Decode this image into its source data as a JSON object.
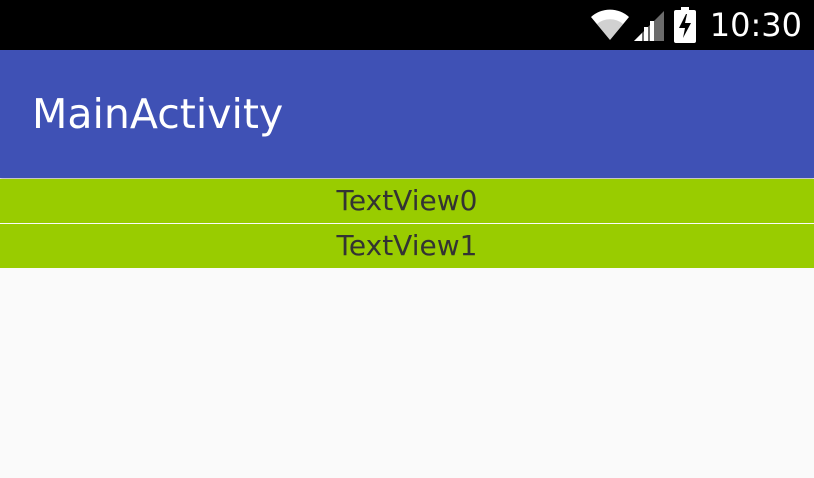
{
  "status_bar": {
    "time": "10:30",
    "icons": [
      "wifi-icon",
      "signal-icon",
      "battery-charging-icon"
    ]
  },
  "app_bar": {
    "title": "MainActivity"
  },
  "content": {
    "items": [
      {
        "label": "TextView0"
      },
      {
        "label": "TextView1"
      }
    ]
  },
  "colors": {
    "status_bar": "#000000",
    "app_bar": "#3f51b5",
    "item_background": "#99cc00",
    "item_text": "#333333",
    "page_background": "#fafafa"
  }
}
